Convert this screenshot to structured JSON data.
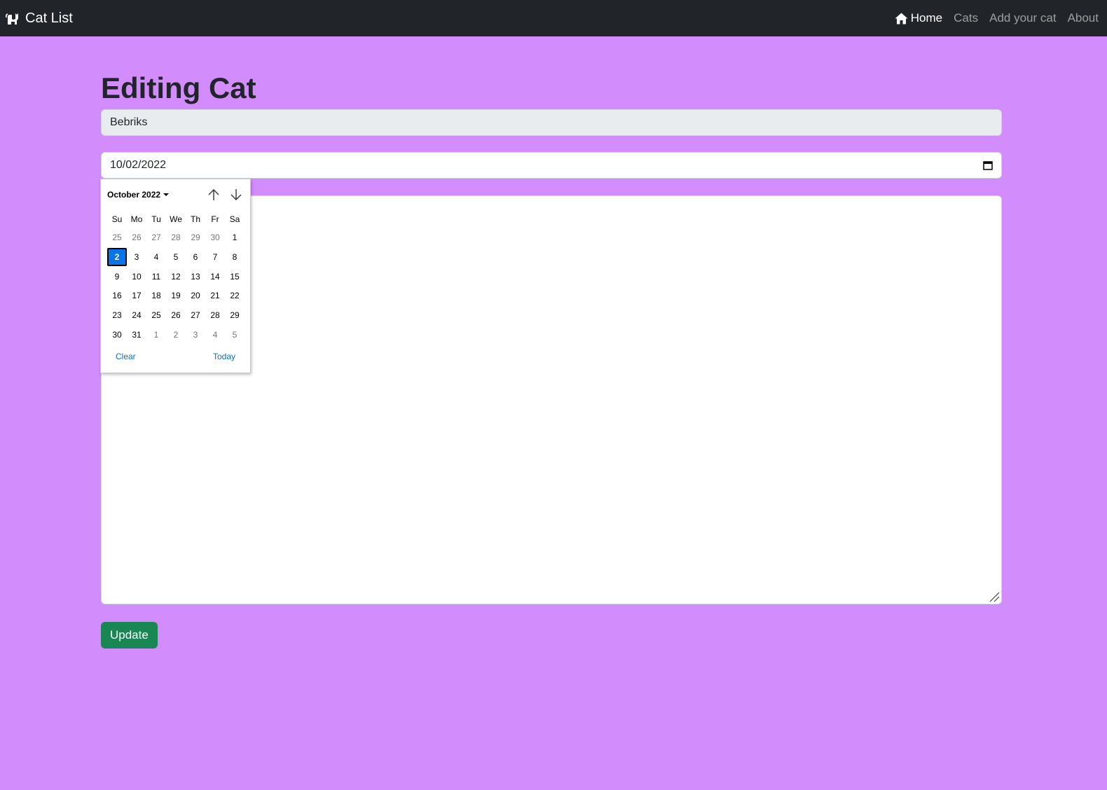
{
  "navbar": {
    "brand": "Cat List",
    "links": [
      {
        "label": "Home",
        "active": true
      },
      {
        "label": "Cats",
        "active": false
      },
      {
        "label": "Add your cat",
        "active": false
      },
      {
        "label": "About",
        "active": false
      }
    ]
  },
  "page": {
    "title": "Editing Cat",
    "name_value": "Bebriks",
    "date_value": "10/02/2022",
    "description_value": "",
    "update_label": "Update"
  },
  "datepicker": {
    "month_label": "October 2022",
    "weekdays": [
      "Su",
      "Mo",
      "Tu",
      "We",
      "Th",
      "Fr",
      "Sa"
    ],
    "weeks": [
      [
        {
          "d": "25",
          "muted": true
        },
        {
          "d": "26",
          "muted": true
        },
        {
          "d": "27",
          "muted": true
        },
        {
          "d": "28",
          "muted": true
        },
        {
          "d": "29",
          "muted": true
        },
        {
          "d": "30",
          "muted": true
        },
        {
          "d": "1",
          "muted": false
        }
      ],
      [
        {
          "d": "2",
          "muted": false,
          "selected": true
        },
        {
          "d": "3",
          "muted": false
        },
        {
          "d": "4",
          "muted": false
        },
        {
          "d": "5",
          "muted": false
        },
        {
          "d": "6",
          "muted": false
        },
        {
          "d": "7",
          "muted": false
        },
        {
          "d": "8",
          "muted": false
        }
      ],
      [
        {
          "d": "9",
          "muted": false
        },
        {
          "d": "10",
          "muted": false
        },
        {
          "d": "11",
          "muted": false
        },
        {
          "d": "12",
          "muted": false
        },
        {
          "d": "13",
          "muted": false
        },
        {
          "d": "14",
          "muted": false
        },
        {
          "d": "15",
          "muted": false
        }
      ],
      [
        {
          "d": "16",
          "muted": false
        },
        {
          "d": "17",
          "muted": false
        },
        {
          "d": "18",
          "muted": false
        },
        {
          "d": "19",
          "muted": false
        },
        {
          "d": "20",
          "muted": false
        },
        {
          "d": "21",
          "muted": false
        },
        {
          "d": "22",
          "muted": false
        }
      ],
      [
        {
          "d": "23",
          "muted": false
        },
        {
          "d": "24",
          "muted": false
        },
        {
          "d": "25",
          "muted": false
        },
        {
          "d": "26",
          "muted": false
        },
        {
          "d": "27",
          "muted": false
        },
        {
          "d": "28",
          "muted": false
        },
        {
          "d": "29",
          "muted": false
        }
      ],
      [
        {
          "d": "30",
          "muted": false
        },
        {
          "d": "31",
          "muted": false
        },
        {
          "d": "1",
          "muted": true
        },
        {
          "d": "2",
          "muted": true
        },
        {
          "d": "3",
          "muted": true
        },
        {
          "d": "4",
          "muted": true
        },
        {
          "d": "5",
          "muted": true
        }
      ]
    ],
    "clear_label": "Clear",
    "today_label": "Today"
  },
  "colors": {
    "page_background": "#d38cfc",
    "navbar_background": "#212529",
    "update_button": "#198754",
    "selected_day": "#0a75e8",
    "link": "#0a6ec2"
  },
  "icons": {
    "brand": "cat-icon",
    "home": "house-icon",
    "calendar": "calendar-icon",
    "prev": "arrow-up-icon",
    "next": "arrow-down-icon",
    "resize": "resize-grip-icon"
  }
}
